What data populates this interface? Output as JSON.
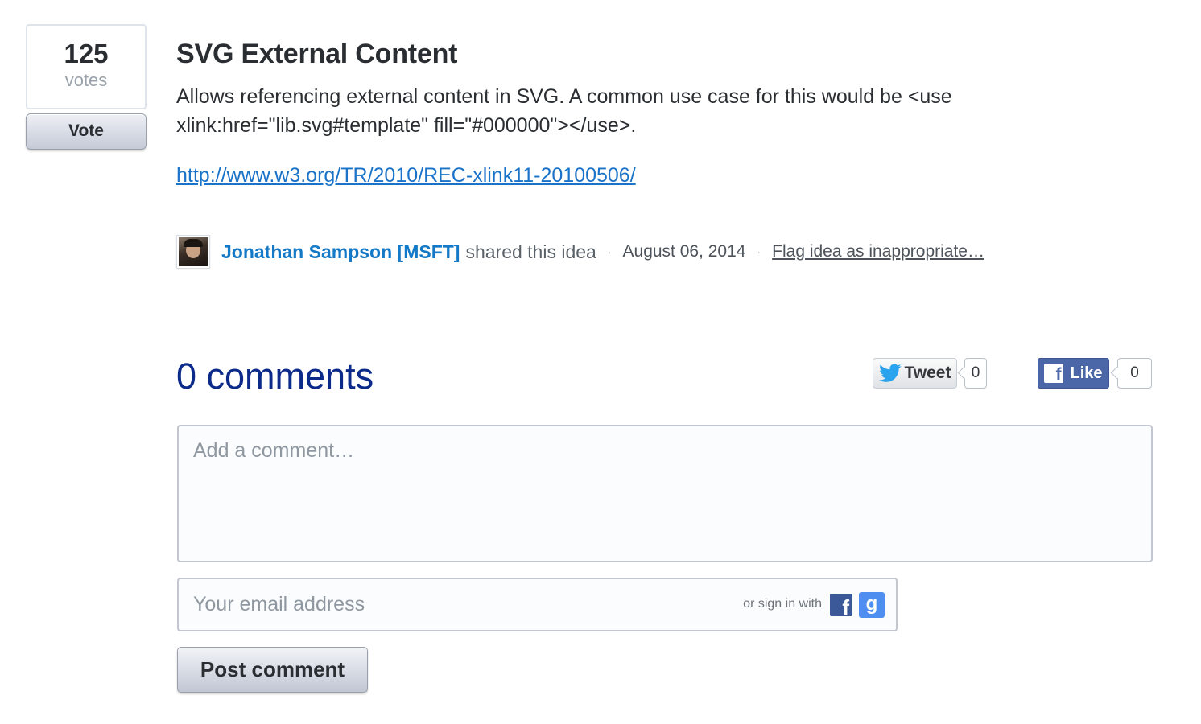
{
  "vote": {
    "count": "125",
    "label": "votes",
    "button_label": "Vote"
  },
  "idea": {
    "title": "SVG External Content",
    "description": "Allows referencing external content in SVG. A common use case for this would be <use xlink:href=\"lib.svg#template\" fill=\"#000000\"></use>.",
    "link": "http://www.w3.org/TR/2010/REC-xlink11-20100506/",
    "author": "Jonathan Sampson [MSFT]",
    "shared_text": "shared this idea",
    "separator": "·",
    "date": "August 06, 2014",
    "flag_label": "Flag idea as inappropriate…"
  },
  "comments": {
    "title": "0 comments",
    "comment_placeholder": "Add a comment…",
    "email_placeholder": "Your email address",
    "signin_text": "or sign in with",
    "post_label": "Post comment"
  },
  "social": {
    "tweet_label": "Tweet",
    "tweet_count": "0",
    "like_label": "Like",
    "like_count": "0",
    "facebook_icon": "f",
    "google_icon": "g"
  },
  "colors": {
    "link": "#1a73c8",
    "author": "#1479c6",
    "comments_title": "#0b2a8a",
    "facebook": "#4b67a8",
    "google": "#4d8ef0"
  }
}
